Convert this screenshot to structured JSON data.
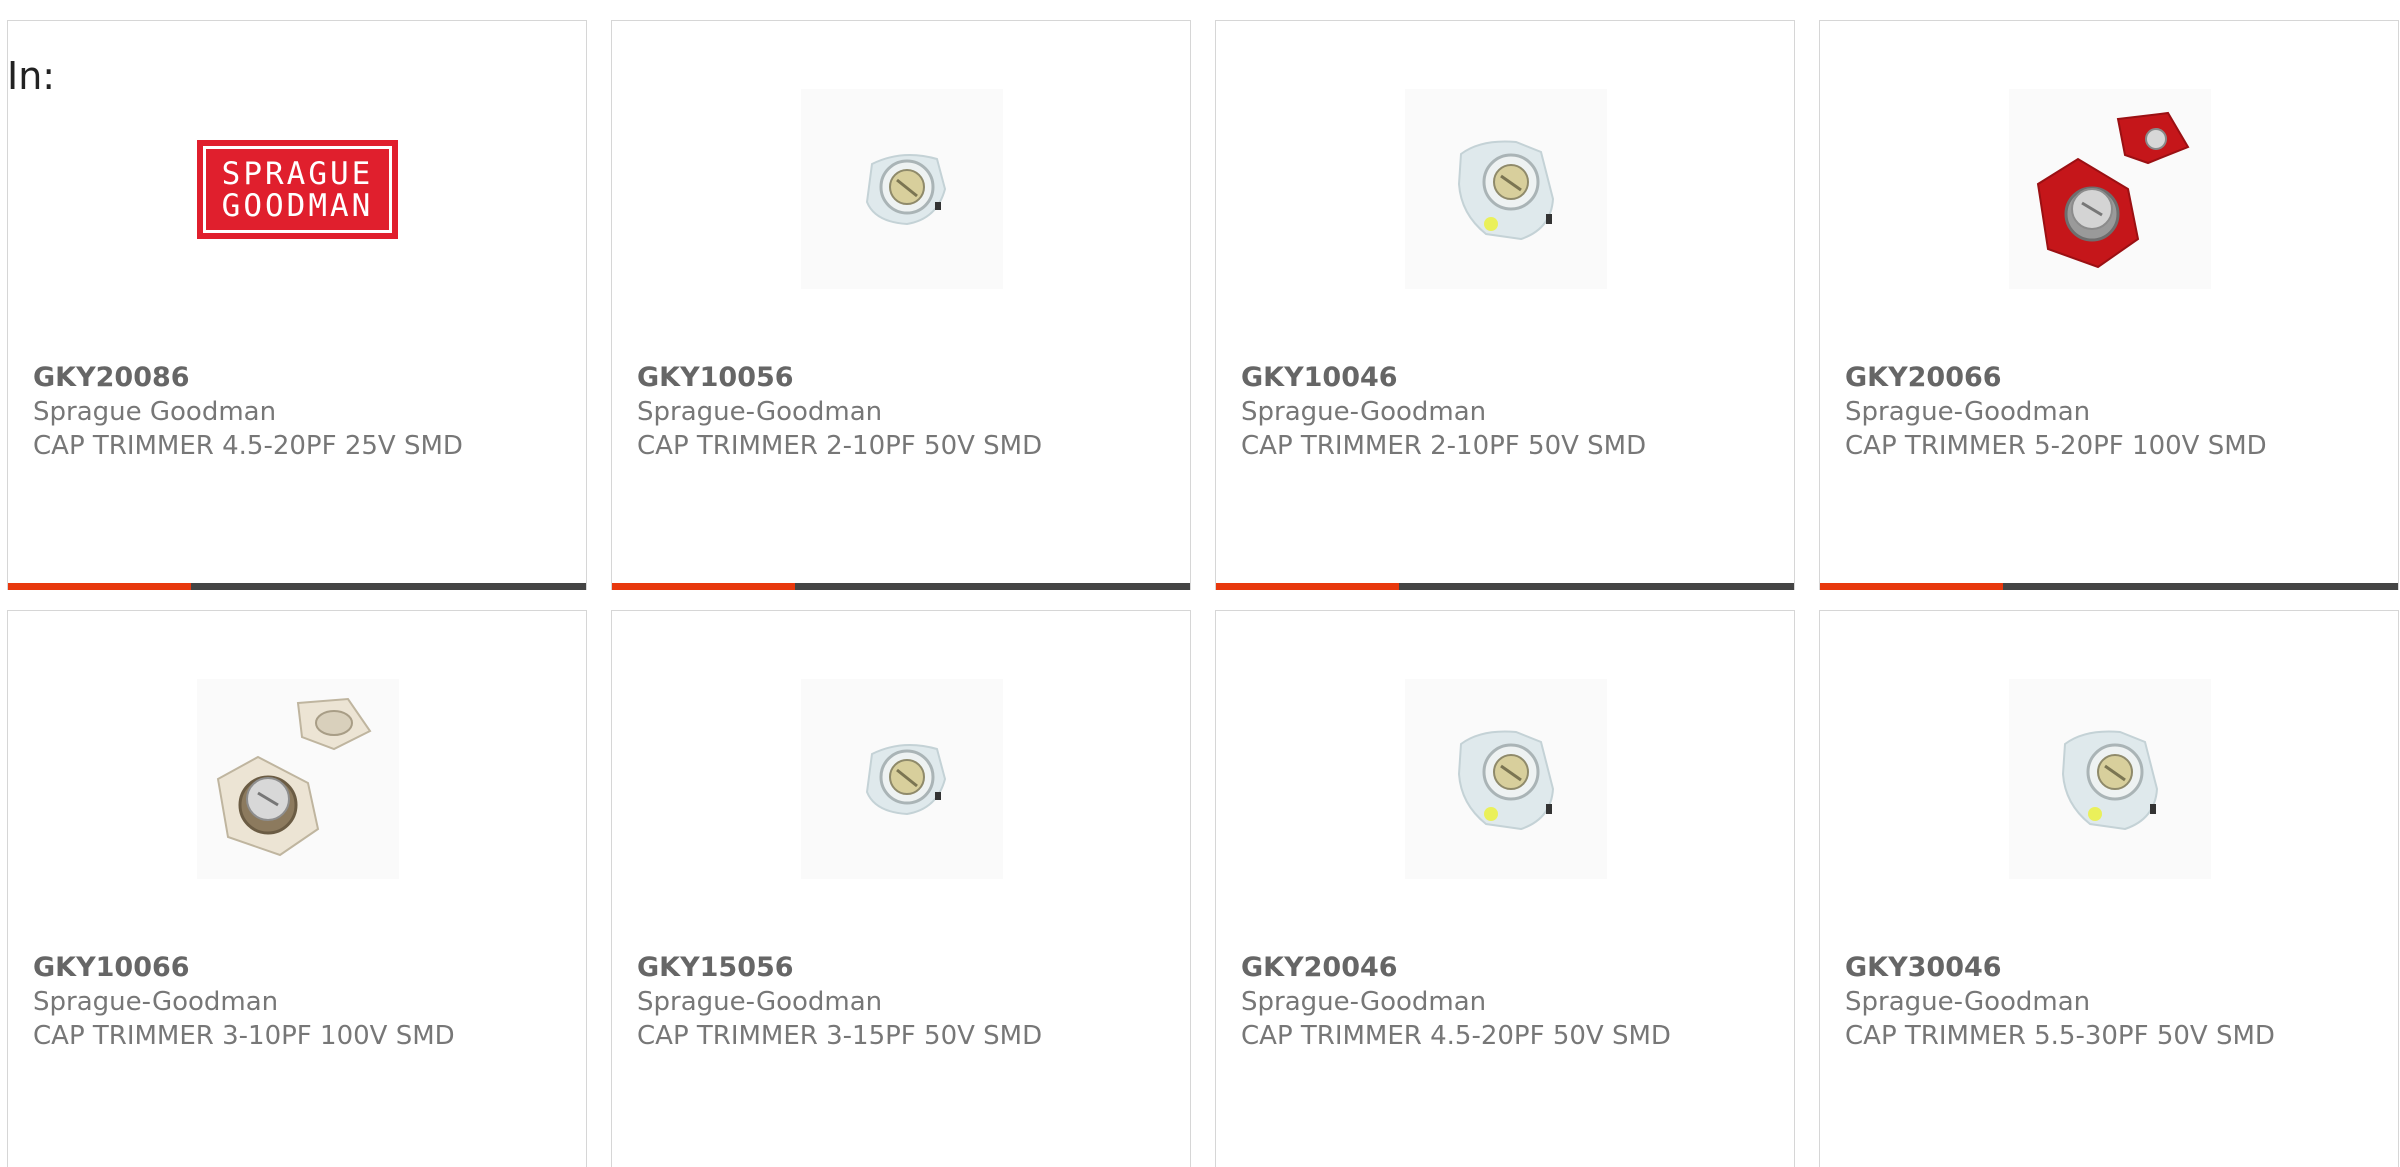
{
  "header": {
    "in_label": "In:"
  },
  "colors": {
    "accent_bar": "#e8380d",
    "dark_bar": "#444444",
    "logo_red": "#e01f2d"
  },
  "products": [
    {
      "part_number": "GKY20086",
      "manufacturer": "Sprague Goodman",
      "description": "CAP TRIMMER 4.5-20PF 25V SMD",
      "image_type": "brand-logo",
      "logo_text": [
        "SPRAGUE",
        "GOODMAN"
      ]
    },
    {
      "part_number": "GKY10056",
      "manufacturer": "Sprague-Goodman",
      "description": "CAP TRIMMER 2-10PF 50V SMD",
      "image_type": "white-trimmer-small"
    },
    {
      "part_number": "GKY10046",
      "manufacturer": "Sprague-Goodman",
      "description": "CAP TRIMMER 2-10PF 50V SMD",
      "image_type": "white-trimmer-yellow"
    },
    {
      "part_number": "GKY20066",
      "manufacturer": "Sprague-Goodman",
      "description": "CAP TRIMMER 5-20PF 100V SMD",
      "image_type": "red-trimmer-pair"
    },
    {
      "part_number": "GKY10066",
      "manufacturer": "Sprague-Goodman",
      "description": "CAP TRIMMER 3-10PF 100V SMD",
      "image_type": "beige-trimmer-pair"
    },
    {
      "part_number": "GKY15056",
      "manufacturer": "Sprague-Goodman",
      "description": "CAP TRIMMER 3-15PF 50V SMD",
      "image_type": "white-trimmer-small"
    },
    {
      "part_number": "GKY20046",
      "manufacturer": "Sprague-Goodman",
      "description": "CAP TRIMMER 4.5-20PF 50V SMD",
      "image_type": "white-trimmer-yellow"
    },
    {
      "part_number": "GKY30046",
      "manufacturer": "Sprague-Goodman",
      "description": "CAP TRIMMER 5.5-30PF 50V SMD",
      "image_type": "white-trimmer-yellow"
    }
  ]
}
